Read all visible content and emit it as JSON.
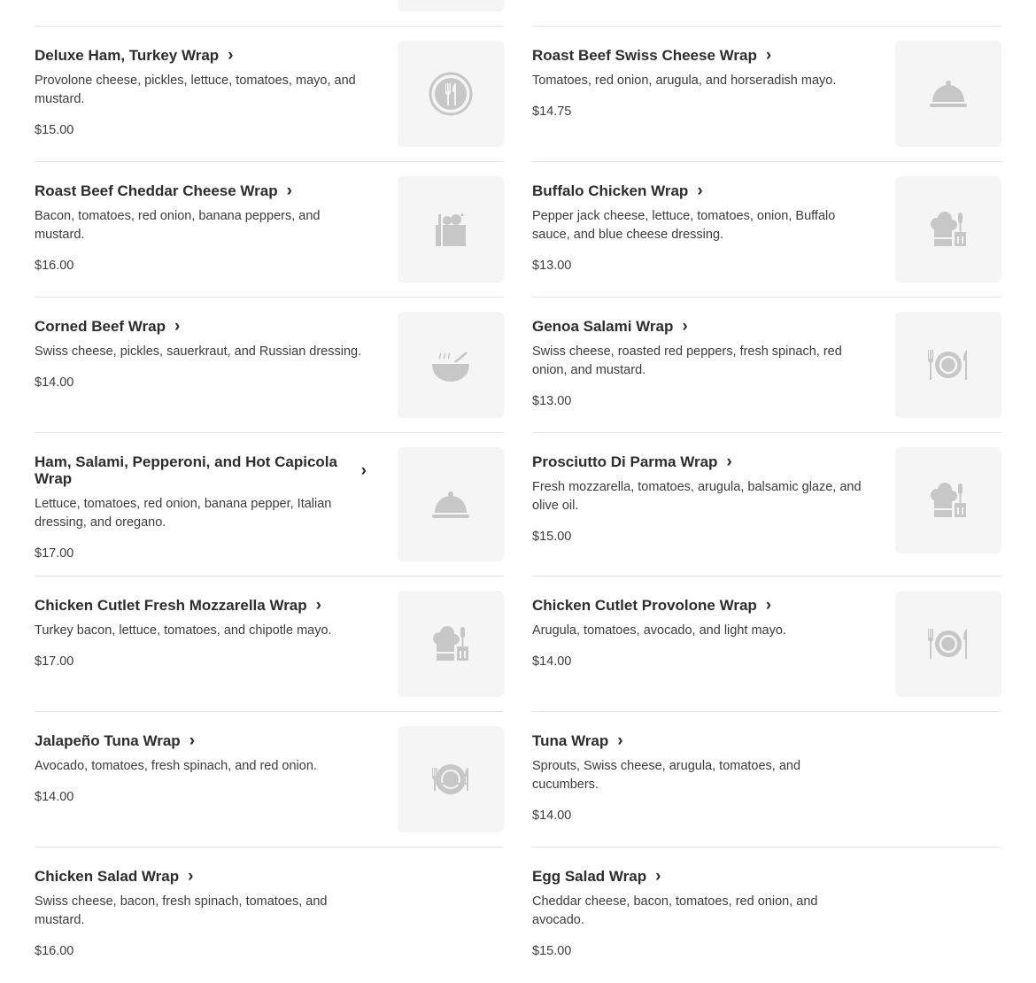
{
  "colors": {
    "text": "#2d2d2d",
    "muted": "#3c3c3c",
    "divider": "#e4e4e4",
    "thumb_bg": "#f5f5f5",
    "icon": "#c7c7c7"
  },
  "left_column": [
    {
      "name": "Deluxe Ham, Turkey Wrap",
      "description": "Provolone cheese, pickles, lettuce, tomatoes, mayo, and mustard.",
      "price": "$15.00",
      "icon": "fork-knife-plate-icon"
    },
    {
      "name": "Roast Beef Cheddar Cheese Wrap",
      "description": "Bacon, tomatoes, red onion, banana peppers, and mustard.",
      "price": "$16.00",
      "icon": "grocery-bag-icon"
    },
    {
      "name": "Corned Beef Wrap",
      "description": "Swiss cheese, pickles, sauerkraut, and Russian dressing.",
      "price": "$14.00",
      "icon": "soup-bowl-icon"
    },
    {
      "name": "Ham, Salami, Pepperoni, and Hot Capicola Wrap",
      "description": "Lettuce, tomatoes, red onion, banana pepper, Italian dressing, and oregano.",
      "price": "$17.00",
      "icon": "food-cloche-icon"
    },
    {
      "name": "Chicken Cutlet Fresh Mozzarella Wrap",
      "description": "Turkey bacon, lettuce, tomatoes, and chipotle mayo.",
      "price": "$17.00",
      "icon": "chef-hat-spatula-icon"
    },
    {
      "name": "Jalapeño Tuna Wrap",
      "description": "Avocado, tomatoes, fresh spinach, and red onion.",
      "price": "$14.00",
      "icon": "plate-utensils-icon"
    },
    {
      "name": "Chicken Salad Wrap",
      "description": "Swiss cheese, bacon, fresh spinach, tomatoes, and mustard.",
      "price": "$16.00",
      "icon": ""
    }
  ],
  "right_column": [
    {
      "name": "Roast Beef Swiss Cheese Wrap",
      "description": "Tomatoes, red onion, arugula, and horseradish mayo.",
      "price": "$14.75",
      "icon": "food-cloche-icon"
    },
    {
      "name": "Buffalo Chicken Wrap",
      "description": "Pepper jack cheese, lettuce, tomatoes, onion, Buffalo sauce, and blue cheese dressing.",
      "price": "$13.00",
      "icon": "chef-hat-spatula-icon"
    },
    {
      "name": "Genoa Salami Wrap",
      "description": "Swiss cheese, roasted red peppers, fresh spinach, red onion, and mustard.",
      "price": "$13.00",
      "icon": "plate-setting-icon"
    },
    {
      "name": "Prosciutto Di Parma Wrap",
      "description": "Fresh mozzarella, tomatoes, arugula, balsamic glaze, and olive oil.",
      "price": "$15.00",
      "icon": "chef-hat-spatula-icon"
    },
    {
      "name": "Chicken Cutlet Provolone Wrap",
      "description": "Arugula, tomatoes, avocado, and light mayo.",
      "price": "$14.00",
      "icon": "plate-setting-icon"
    },
    {
      "name": "Tuna Wrap",
      "description": "Sprouts, Swiss cheese, arugula, tomatoes, and cucumbers.",
      "price": "$14.00",
      "icon": ""
    },
    {
      "name": "Egg Salad Wrap",
      "description": "Cheddar cheese, bacon, tomatoes, red onion, and avocado.",
      "price": "$15.00",
      "icon": ""
    }
  ]
}
